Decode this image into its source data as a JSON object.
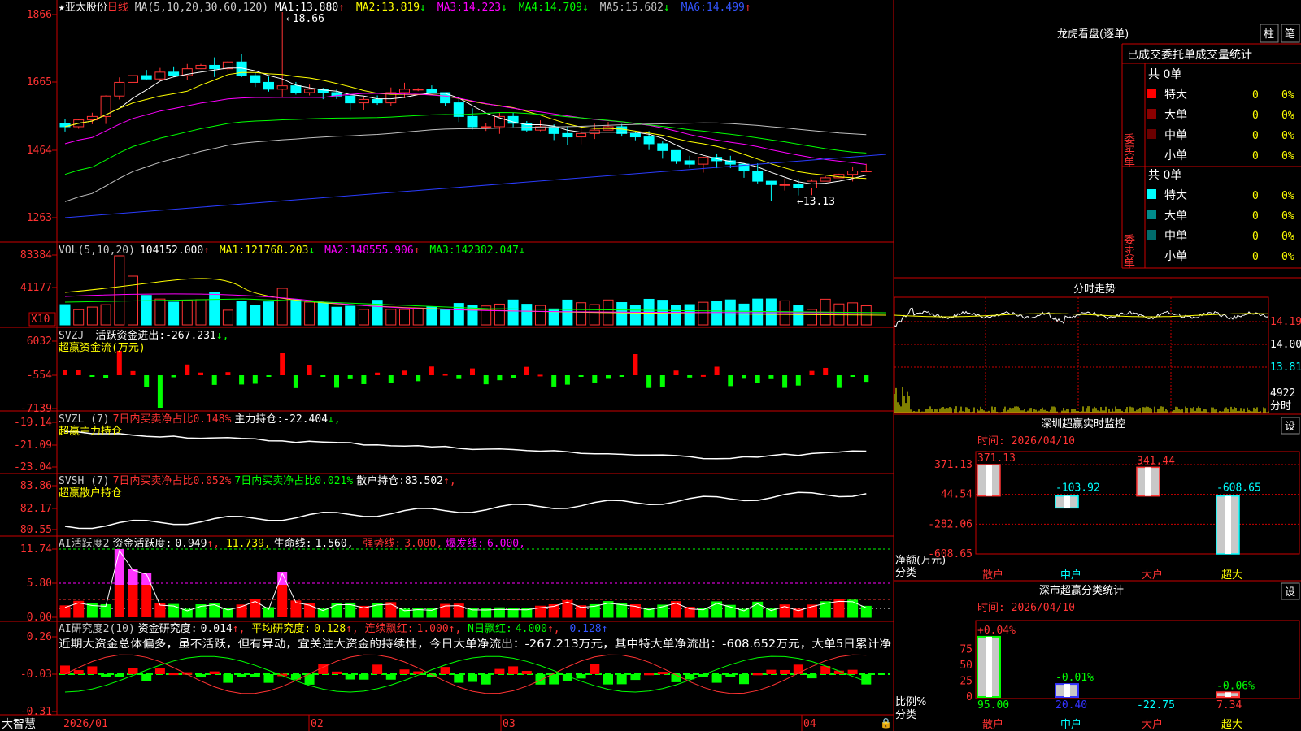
{
  "stock": {
    "star": "★",
    "name": "亚太股份",
    "period": "日线",
    "ma_label": "MA(5,10,20,30,60,120)",
    "ma": [
      {
        "label": "MA1:",
        "value": "13.880",
        "arrow": "↑",
        "color": "#ffffff"
      },
      {
        "label": "MA2:",
        "value": "13.819",
        "arrow": "↓",
        "color": "#ffff00"
      },
      {
        "label": "MA3:",
        "value": "14.223",
        "arrow": "↓",
        "color": "#ff00ff"
      },
      {
        "label": "MA4:",
        "value": "14.709",
        "arrow": "↓",
        "color": "#00ff00"
      },
      {
        "label": "MA5:",
        "value": "15.682",
        "arrow": "↓",
        "color": "#c0c0c0"
      },
      {
        "label": "MA6:",
        "value": "14.499",
        "arrow": "↑",
        "color": "#0000ff"
      }
    ],
    "high_mark": "18.66",
    "low_mark": "13.13",
    "yticks": [
      "1866",
      "1665",
      "1464",
      "1263"
    ]
  },
  "vol": {
    "label": "VOL(5,10,20)",
    "value": "104152.000",
    "arrow": "↑",
    "ma": [
      {
        "label": "MA1:",
        "value": "121768.203",
        "arrow": "↓",
        "color": "#ffff00"
      },
      {
        "label": "MA2:",
        "value": "148555.906",
        "arrow": "↑",
        "color": "#ff00ff"
      },
      {
        "label": "MA3:",
        "value": "142382.047",
        "arrow": "↓",
        "color": "#00ff00"
      }
    ],
    "yticks": [
      "83384",
      "41177"
    ],
    "unit": "X10"
  },
  "svzj": {
    "label": "SVZJ",
    "desc": "活跃资金进出:",
    "value": "-267.231",
    "arrow": "↓,",
    "sub": "超赢资金流(万元)",
    "yticks": [
      "6032",
      "-554",
      "-7139"
    ]
  },
  "svzl": {
    "label": "SVZL (7)",
    "a": "7日内买卖净占比0.148%",
    "b": "主力持仓:",
    "value": "-22.404",
    "arrow": "↓,",
    "sub": "超赢主力持仓",
    "yticks": [
      "-19.14",
      "-21.09",
      "-23.04"
    ]
  },
  "svsh": {
    "label": "SVSH (7)",
    "a": "7日内买卖净占比0.052%",
    "b": "7日内买卖净占比0.021%",
    "c": "散户持仓:",
    "value": "83.502",
    "arrow": "↑,",
    "sub": "超赢散户持仓",
    "yticks": [
      "83.86",
      "82.17",
      "80.55"
    ]
  },
  "ai1": {
    "label": "AI活跃度2",
    "a": "资金活跃度:",
    "av": "0.949",
    "aar": "↑,",
    "b": "11.739,",
    "c": "生命线:",
    "cv": "1.560,",
    "d": "强势线:",
    "dv": "3.000,",
    "e": "爆发线:",
    "ev": "6.000,",
    "yticks": [
      "11.74",
      "5.80",
      "0.00"
    ]
  },
  "ai2": {
    "label": "AI研究度2(10)",
    "a": "资金研究度:",
    "av": "0.014",
    "aar": "↑,",
    "b": "平均研究度:",
    "bv": "0.128",
    "bar": "↑,",
    "c": "连续飘红:",
    "cv": "1.000",
    "car": "↑,",
    "d": "N日飘红:",
    "dv": "4.000",
    "dar": "↑,",
    "e": "0.128",
    "ear": "↑",
    "comment": "近期大资金总体偏多，虽不活跃，但有异动，宜关注大资金的持续性，今日大单净流出：-267.213万元，其中特大单净流出：-608.652万元，大单5日累计净",
    "yticks": [
      "0.26",
      "-0.03",
      "-0.31"
    ]
  },
  "xaxis": {
    "labels": [
      "2026/01",
      "02",
      "03",
      "04"
    ],
    "brand": "大智慧"
  },
  "right": {
    "lhb_title": "龙虎看盘(逐单)",
    "btn1": "柱",
    "btn2": "笔",
    "stat_header": "已成交委托单成交量统计",
    "buy_label": "委买单",
    "sell_label": "委卖单",
    "buy_total": "共 0单",
    "sell_total": "共 0单",
    "buy_rows": [
      {
        "name": "特大",
        "n": "0",
        "p": "0%",
        "color": "#ff0000"
      },
      {
        "name": "大单",
        "n": "0",
        "p": "0%",
        "color": "#8b0000"
      },
      {
        "name": "中单",
        "n": "0",
        "p": "0%",
        "color": "#6b0000"
      },
      {
        "name": "小单",
        "n": "0",
        "p": "0%",
        "color": "#000000"
      }
    ],
    "sell_rows": [
      {
        "name": "特大",
        "n": "0",
        "p": "0%",
        "color": "#00ffff"
      },
      {
        "name": "大单",
        "n": "0",
        "p": "0%",
        "color": "#008b8b"
      },
      {
        "name": "中单",
        "n": "0",
        "p": "0%",
        "color": "#006b6b"
      },
      {
        "name": "小单",
        "n": "0",
        "p": "0%",
        "color": "#000000"
      }
    ],
    "fs_title": "分时走势",
    "fs_y": [
      "14.19",
      "14.00",
      "13.81"
    ],
    "fs_vol": "4922",
    "fs_vol_unit": "分时",
    "sz_title": "深圳超赢实时监控",
    "sz_btn": "设",
    "sz_time": "时间: 2026/04/10",
    "sz_y": [
      "371.13",
      "44.54",
      "-282.06",
      "-608.65"
    ],
    "sz_unit1": "净额(万元)",
    "sz_unit2": "分类",
    "sz_bars": [
      {
        "cat": "散户",
        "value": 371.13,
        "label": "371.13"
      },
      {
        "cat": "中户",
        "value": -103.92,
        "label": "-103.92"
      },
      {
        "cat": "大户",
        "value": 341.44,
        "label": "341.44"
      },
      {
        "cat": "超大",
        "value": -608.65,
        "label": "-608.65"
      }
    ],
    "fl_title": "深市超赢分类统计",
    "fl_btn": "设",
    "fl_time": "时间: 2026/04/10",
    "fl_y": [
      "75",
      "50",
      "25",
      "0"
    ],
    "fl_unit1": "比例%",
    "fl_unit2": "分类",
    "fl_bars": [
      {
        "cat": "散户",
        "pct": "+0.04%",
        "val": "95.00",
        "h": 95
      },
      {
        "cat": "中户",
        "pct": "-0.01%",
        "val": "20.40",
        "h": 20.4
      },
      {
        "cat": "大户",
        "pct": "",
        "val": "-22.75",
        "h": 0
      },
      {
        "cat": "超大",
        "pct": "-0.06%",
        "val": "7.34",
        "h": 7.34
      }
    ]
  },
  "chart_data": {
    "type": "candlestick",
    "x_range": [
      "2026/01",
      "2026/04/10"
    ],
    "price_range": [
      12.63,
      18.66
    ],
    "high": 18.66,
    "low": 13.13,
    "ma_values": {
      "MA1": 13.88,
      "MA2": 13.819,
      "MA3": 14.223,
      "MA4": 14.709,
      "MA5": 15.682,
      "MA6": 14.499
    },
    "volume": 104152.0,
    "svzj": -267.231,
    "svzl": -22.404,
    "svsh": 83.502,
    "ai_activity": 0.949,
    "ai_research": 0.014,
    "sz_net": {
      "散户": 371.13,
      "中户": -103.92,
      "大户": 341.44,
      "超大": -608.65
    },
    "sz_ratio": {
      "散户": 95.0,
      "中户": 20.4,
      "大户": -22.75,
      "超大": 7.34
    }
  }
}
